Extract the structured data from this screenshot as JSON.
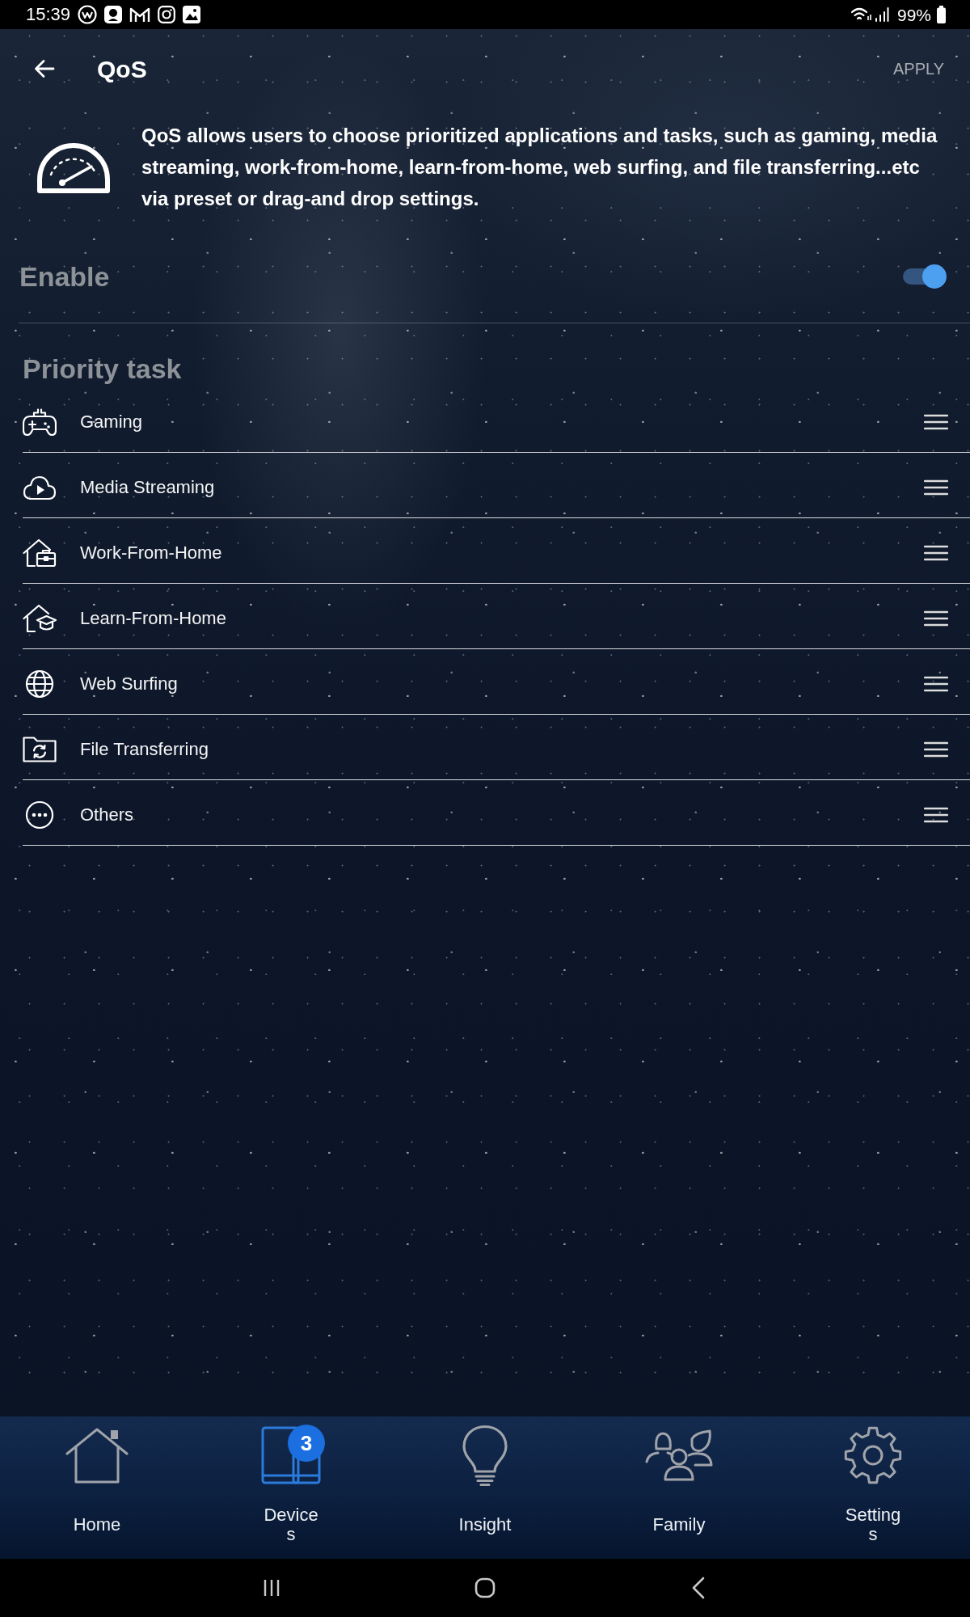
{
  "status_bar": {
    "time": "15:39",
    "battery": "99%"
  },
  "header": {
    "title": "QoS",
    "action": "APPLY"
  },
  "intro": {
    "text": "QoS allows users to choose prioritized applications and tasks, such as gaming, media streaming, work-from-home, learn-from-home, web surfing, and file transferring...etc via preset or drag-and drop settings."
  },
  "enable": {
    "label": "Enable",
    "on": true
  },
  "priority": {
    "title": "Priority task",
    "tasks": [
      {
        "label": "Gaming"
      },
      {
        "label": "Media Streaming"
      },
      {
        "label": "Work-From-Home"
      },
      {
        "label": "Learn-From-Home"
      },
      {
        "label": "Web Surfing"
      },
      {
        "label": "File Transferring"
      },
      {
        "label": "Others"
      }
    ]
  },
  "nav": {
    "items": [
      {
        "label": "Home",
        "selected": false
      },
      {
        "label": "Devices",
        "selected": true,
        "badge": "3"
      },
      {
        "label": "Insight",
        "selected": false
      },
      {
        "label": "Family",
        "selected": false
      },
      {
        "label": "Settings",
        "selected": false
      }
    ]
  }
}
